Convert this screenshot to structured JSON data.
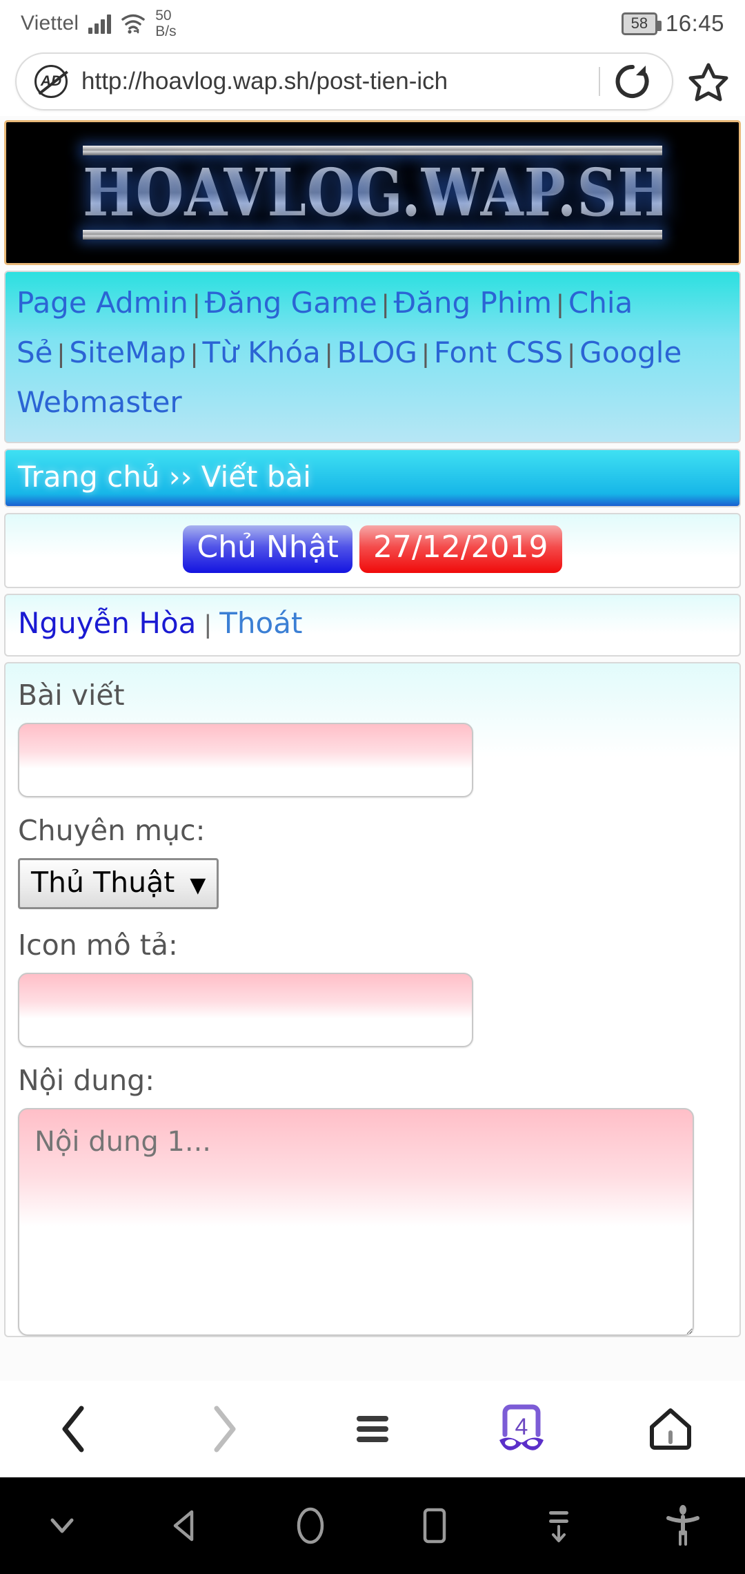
{
  "status_bar": {
    "carrier": "Viettel",
    "speed_value": "50",
    "speed_unit": "B/s",
    "battery": "58",
    "time": "16:45",
    "signal_icon": "signal-bars-icon",
    "wifi_icon": "wifi-icon"
  },
  "browser": {
    "url": "http://hoavlog.wap.sh/post-tien-ich",
    "adblock_icon": "adblock-icon",
    "adblock_label": "AD",
    "reload_icon": "reload-icon",
    "bookmark_icon": "star-icon",
    "bottom_bar": {
      "back_icon": "chevron-left-icon",
      "forward_icon": "chevron-right-icon",
      "menu_icon": "hamburger-menu-icon",
      "tabs_icon": "incognito-tabs-icon",
      "tabs_count": "4",
      "home_icon": "home-icon"
    }
  },
  "android_nav": {
    "hide_keyboard_icon": "chevron-down-icon",
    "back_icon": "back-triangle-icon",
    "home_icon": "home-circle-icon",
    "recents_icon": "recents-square-icon",
    "scroll_down_icon": "scroll-down-icon",
    "accessibility_icon": "accessibility-person-icon"
  },
  "site": {
    "banner_text": "HOAVLOG.WAP.SH",
    "nav_links": [
      "Page Admin",
      "Đăng Game",
      "Đăng Phim",
      "Chia Sẻ",
      "SiteMap",
      "Từ Khóa",
      "BLOG",
      "Font CSS",
      "Google Webmaster"
    ],
    "nav_separator": "|",
    "breadcrumb": "Trang chủ ›› Viết bài",
    "date": {
      "weekday": "Chủ Nhật",
      "value": "27/12/2019"
    },
    "user": {
      "name": "Nguyễn Hòa",
      "separator": "|",
      "logout": "Thoát"
    }
  },
  "form": {
    "title_label": "Bài viết",
    "title_value": "",
    "title_placeholder": "",
    "category_label": "Chuyên mục:",
    "category_value": "Thủ Thuật",
    "category_arrow": "▼",
    "icon_label": "Icon mô tả:",
    "icon_value": "",
    "icon_placeholder": "",
    "content_label": "Nội dung:",
    "content_value": "",
    "content_placeholder": "Nội dung 1..."
  },
  "colors": {
    "nav_link": "#2b64d4",
    "nav_bg_top": "#2ce0e0",
    "nav_bg_bottom": "#b6e6f5",
    "crumb_top": "#3fe0f2",
    "crumb_bottom": "#1b5fd0",
    "badge_day": "#1414e0",
    "badge_date": "#f00a0a",
    "input_pink": "#ffbfc8",
    "banner_border": "#e8b878",
    "tabs_purple": "#6b46c1"
  }
}
